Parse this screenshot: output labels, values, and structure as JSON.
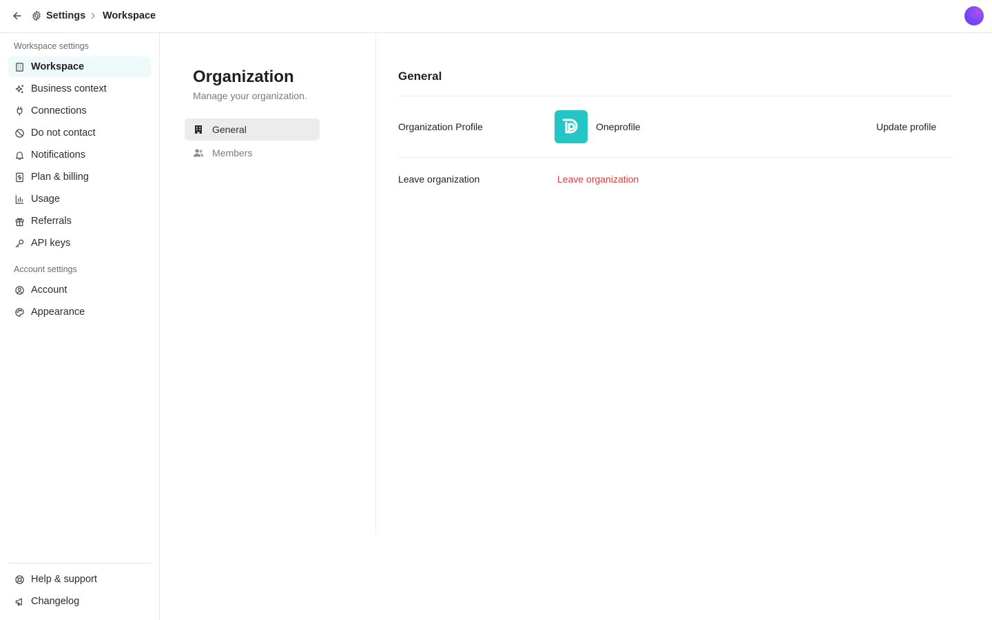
{
  "topbar": {
    "breadcrumb": [
      "Settings",
      "Workspace"
    ],
    "icons": [
      "arrow-left-icon",
      "gear-icon",
      "chevron-right-icon"
    ]
  },
  "sidebar": {
    "workspace_section": "Workspace settings",
    "workspace_items": [
      {
        "label": "Workspace",
        "icon": "building-icon",
        "active": true
      },
      {
        "label": "Business context",
        "icon": "sparkles-icon"
      },
      {
        "label": "Connections",
        "icon": "plug-icon"
      },
      {
        "label": "Do not contact",
        "icon": "ban-icon"
      },
      {
        "label": "Notifications",
        "icon": "bell-icon"
      },
      {
        "label": "Plan & billing",
        "icon": "dollar-receipt-icon"
      },
      {
        "label": "Usage",
        "icon": "bar-chart-icon"
      },
      {
        "label": "Referrals",
        "icon": "gift-icon"
      },
      {
        "label": "API keys",
        "icon": "key-icon"
      }
    ],
    "account_section": "Account settings",
    "account_items": [
      {
        "label": "Account",
        "icon": "user-circle-icon"
      },
      {
        "label": "Appearance",
        "icon": "palette-icon"
      }
    ],
    "footer_items": [
      {
        "label": "Help & support",
        "icon": "lifebuoy-icon"
      },
      {
        "label": "Changelog",
        "icon": "megaphone-icon"
      }
    ]
  },
  "organization": {
    "title": "Organization",
    "subtitle": "Manage your organization.",
    "nav": [
      {
        "label": "General",
        "icon": "office-building-icon",
        "active": true
      },
      {
        "label": "Members",
        "icon": "users-icon"
      }
    ]
  },
  "general": {
    "title": "General",
    "profile_label": "Organization Profile",
    "org_name": "Oneprofile",
    "update_label": "Update profile",
    "leave_label": "Leave organization",
    "leave_button": "Leave organization"
  },
  "colors": {
    "accent": "#24c5c5",
    "danger": "#e03a3a",
    "active_bg": "#eef9f9"
  }
}
